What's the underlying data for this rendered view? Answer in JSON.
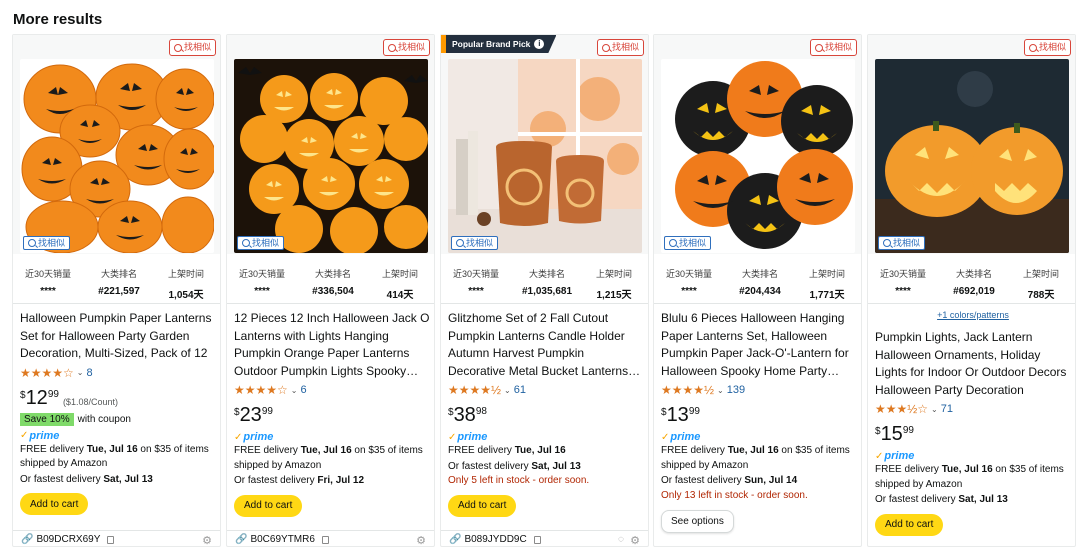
{
  "page_title": "More results",
  "find_similar_label": "找相似",
  "stat_labels": {
    "sales30": "近30天销量",
    "rank": "大类排名",
    "listed": "上架时间"
  },
  "cards": [
    {
      "badge": "",
      "stats": {
        "sales30": "****",
        "rank": "#221,597",
        "listed": "1,054天"
      },
      "colors_link": "",
      "title": "Halloween Pumpkin Paper Lanterns Set for Halloween Party Garden Decoration, Multi-Sized, Pack of 12",
      "stars": "★★★★☆",
      "reviews": "8",
      "price": {
        "currency": "$",
        "whole": "12",
        "fraction": "99",
        "unit": "($1.08/Count)"
      },
      "coupon": {
        "badge": "Save 10%",
        "text": "with coupon"
      },
      "prime": "prime",
      "delivery_line1_prefix": "FREE delivery ",
      "delivery_line1_date": "Tue, Jul 16",
      "delivery_line1_suffix": " on $35 of items shipped by Amazon",
      "delivery_line2_prefix": "Or fastest delivery ",
      "delivery_line2_date": "Sat, Jul 13",
      "stock": "",
      "button": "Add to cart",
      "asin": "B09DCRX69Y"
    },
    {
      "badge": "",
      "stats": {
        "sales30": "****",
        "rank": "#336,504",
        "listed": "414天"
      },
      "colors_link": "",
      "title": "12 Pieces 12 Inch Halloween Jack O Lanterns with Lights Hanging Pumpkin Orange Paper Lanterns Outdoor Pumpkin Lights Spooky Halloween Decorations",
      "stars": "★★★★☆",
      "reviews": "6",
      "price": {
        "currency": "$",
        "whole": "23",
        "fraction": "99",
        "unit": ""
      },
      "coupon": {
        "badge": "",
        "text": ""
      },
      "prime": "prime",
      "delivery_line1_prefix": "FREE delivery ",
      "delivery_line1_date": "Tue, Jul 16",
      "delivery_line1_suffix": " on $35 of items shipped by Amazon",
      "delivery_line2_prefix": "Or fastest delivery ",
      "delivery_line2_date": "Fri, Jul 12",
      "stock": "",
      "button": "Add to cart",
      "asin": "B0C69YTMR6"
    },
    {
      "badge": "Popular Brand Pick",
      "stats": {
        "sales30": "****",
        "rank": "#1,035,681",
        "listed": "1,215天"
      },
      "colors_link": "",
      "title": "Glitzhome Set of 2 Fall Cutout Pumpkin Lanterns Candle Holder Autumn Harvest Pumpkin Decorative Metal Bucket Lanterns for Fall Decor",
      "stars": "★★★★½",
      "reviews": "61",
      "price": {
        "currency": "$",
        "whole": "38",
        "fraction": "98",
        "unit": ""
      },
      "coupon": {
        "badge": "",
        "text": ""
      },
      "prime": "prime",
      "delivery_line1_prefix": "FREE delivery ",
      "delivery_line1_date": "Tue, Jul 16",
      "delivery_line1_suffix": "",
      "delivery_line2_prefix": "Or fastest delivery ",
      "delivery_line2_date": "Sat, Jul 13",
      "stock": "Only 5 left in stock - order soon.",
      "button": "Add to cart",
      "asin": "B089JYDD9C"
    },
    {
      "badge": "",
      "stats": {
        "sales30": "****",
        "rank": "#204,434",
        "listed": "1,771天"
      },
      "colors_link": "",
      "title": "Blulu 6 Pieces Halloween Hanging Paper Lanterns Set, Halloween Pumpkin Paper Jack-O'-Lantern for Halloween Spooky Home Party Decorations",
      "stars": "★★★★½",
      "reviews": "139",
      "price": {
        "currency": "$",
        "whole": "13",
        "fraction": "99",
        "unit": ""
      },
      "coupon": {
        "badge": "",
        "text": ""
      },
      "prime": "prime",
      "delivery_line1_prefix": "FREE delivery ",
      "delivery_line1_date": "Tue, Jul 16",
      "delivery_line1_suffix": " on $35 of items shipped by Amazon",
      "delivery_line2_prefix": "Or fastest delivery ",
      "delivery_line2_date": "Sun, Jul 14",
      "stock": "Only 13 left in stock - order soon.",
      "button": "See options",
      "asin": ""
    },
    {
      "badge": "",
      "stats": {
        "sales30": "****",
        "rank": "#692,019",
        "listed": "788天"
      },
      "colors_link": "+1 colors/patterns",
      "title": "Pumpkin Lights, Jack Lantern Halloween Ornaments, Holiday Lights for Indoor Or Outdoor Decors Halloween Party Decoration",
      "stars": "★★★½☆",
      "reviews": "71",
      "price": {
        "currency": "$",
        "whole": "15",
        "fraction": "99",
        "unit": ""
      },
      "coupon": {
        "badge": "",
        "text": ""
      },
      "prime": "prime",
      "delivery_line1_prefix": "FREE delivery ",
      "delivery_line1_date": "Tue, Jul 16",
      "delivery_line1_suffix": " on $35 of items shipped by Amazon",
      "delivery_line2_prefix": "Or fastest delivery ",
      "delivery_line2_date": "Sat, Jul 13",
      "stock": "",
      "button": "Add to cart",
      "asin": ""
    }
  ],
  "colors": {
    "prime_blue": "#1a98ff",
    "star_orange": "#de7921",
    "cart_yellow": "#ffd814",
    "link_blue": "#2162a1",
    "stock_red": "#b12704"
  }
}
